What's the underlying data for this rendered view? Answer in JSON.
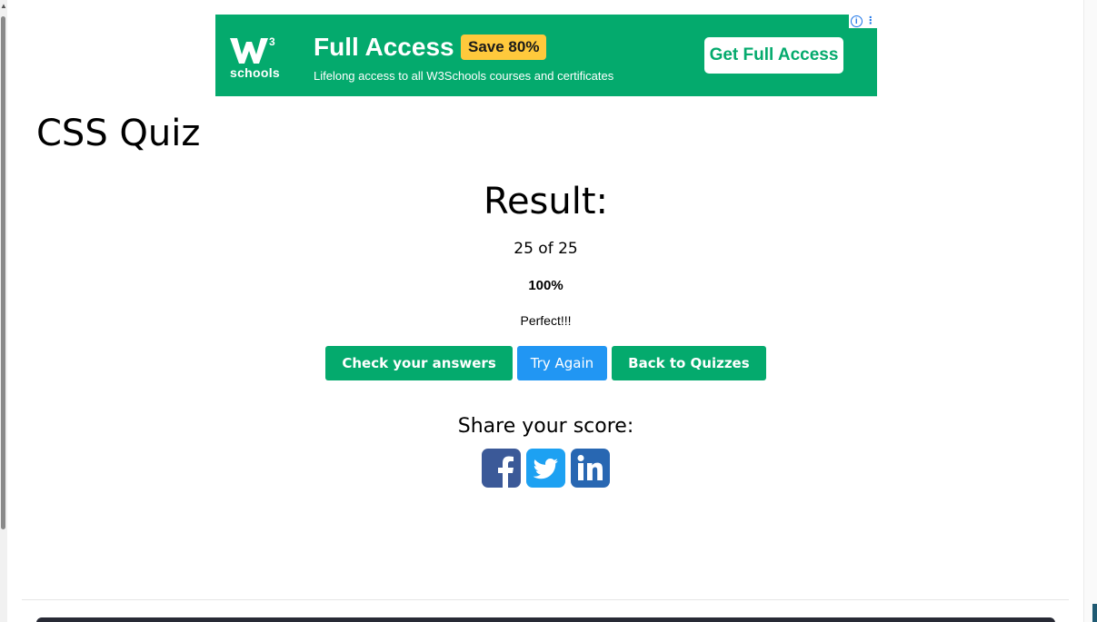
{
  "ad": {
    "logo_text": "schools",
    "logo_sup": "3",
    "headline": "Full Access",
    "badge": "Save 80%",
    "subtext": "Lifelong access to all W3Schools courses and certificates",
    "cta": "Get Full Access",
    "colors": {
      "background": "#04aa6d",
      "badge": "#ffc93c"
    }
  },
  "page": {
    "title": "CSS Quiz"
  },
  "result": {
    "heading": "Result:",
    "score": "25 of 25",
    "percent": "100%",
    "verdict": "Perfect!!!"
  },
  "buttons": {
    "check_answers": "Check your answers",
    "try_again": "Try Again",
    "back_to_quizzes": "Back to Quizzes"
  },
  "share": {
    "label": "Share your score:",
    "networks": [
      "facebook-icon",
      "twitter-icon",
      "linkedin-icon"
    ],
    "colors": {
      "facebook": "#3b5998",
      "twitter": "#1da1f2",
      "linkedin": "#2867b2"
    }
  }
}
